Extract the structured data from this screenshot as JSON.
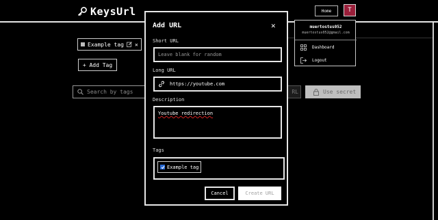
{
  "header": {
    "logo_text": "KeysUrl",
    "home_label": "Home",
    "avatar_initial": "T"
  },
  "page": {
    "tag_chip_label": "Example tag",
    "add_tag_label": "+ Add Tag",
    "search_placeholder": "Search by tags",
    "url_fragment": "RL",
    "use_secret_label": "Use secret"
  },
  "user_menu": {
    "username": "muertostus052",
    "email": "muertostus052@gmail.com",
    "items": [
      {
        "label": "Dashboard",
        "icon": "dashboard-icon"
      },
      {
        "label": "Logout",
        "icon": "logout-icon"
      }
    ]
  },
  "modal": {
    "title": "Add URL",
    "close_symbol": "✕",
    "short_url": {
      "label": "Short URL",
      "placeholder": "Leave blank for random",
      "value": ""
    },
    "long_url": {
      "label": "Long URL",
      "value": "https://youtube.com"
    },
    "description": {
      "label": "Description",
      "value": "Youtube redirection"
    },
    "tags": {
      "label": "Tags",
      "options": [
        {
          "label": "Example tag",
          "checked": true
        }
      ]
    },
    "cancel_label": "Cancel",
    "create_label": "Create URL"
  },
  "colors": {
    "background": "#000000",
    "avatar": "#9a1f3a",
    "checkbox": "#2a6cd8",
    "disabled_button": "#bfbfbf"
  }
}
